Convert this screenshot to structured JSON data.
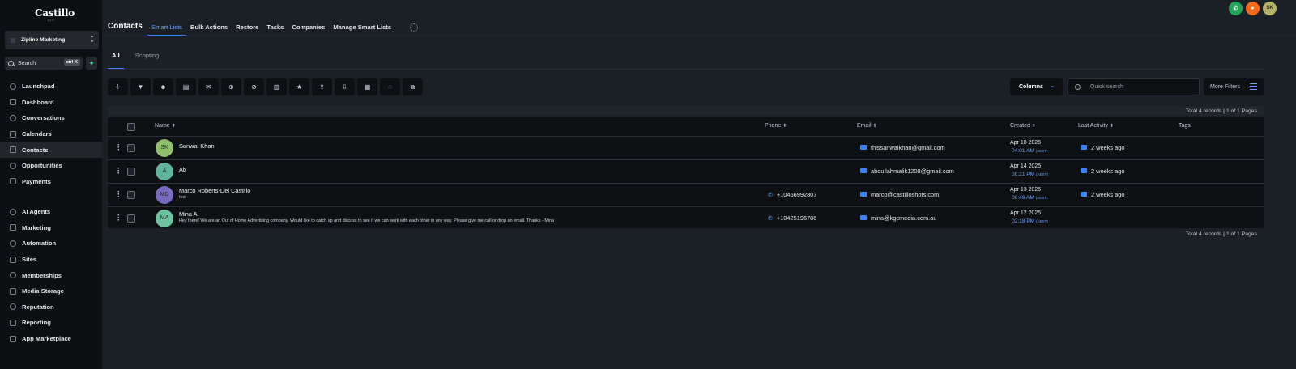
{
  "sidebar": {
    "logo": "Castillo",
    "logo_sub": "LLC",
    "account": "Zipline Marketing",
    "search_label": "Search",
    "search_shortcut": "ctrl K",
    "nav_primary": [
      "Launchpad",
      "Dashboard",
      "Conversations",
      "Calendars",
      "Contacts",
      "Opportunities",
      "Payments"
    ],
    "nav_secondary": [
      "AI Agents",
      "Marketing",
      "Automation",
      "Sites",
      "Memberships",
      "Media Storage",
      "Reputation",
      "Reporting",
      "App Marketplace"
    ],
    "active_item": "Contacts"
  },
  "header": {
    "title": "Contacts",
    "tabs": [
      "Smart Lists",
      "Bulk Actions",
      "Restore",
      "Tasks",
      "Companies",
      "Manage Smart Lists"
    ],
    "active_tab": "Smart Lists",
    "user_initials": "SK"
  },
  "subtabs": [
    "All",
    "Scripting"
  ],
  "toolbar": {
    "icons": [
      "add-icon",
      "filter-icon",
      "robot-icon",
      "sms-icon",
      "email-icon",
      "tag-add-icon",
      "tag-remove-icon",
      "delete-icon",
      "star-icon",
      "export-icon",
      "import-icon",
      "add-to-company-icon",
      "whatsapp-icon",
      "merge-icon"
    ],
    "columns_label": "Columns",
    "search_placeholder": "Quick search",
    "more_filters_label": "More Filters"
  },
  "records_summary": "Total 4 records | 1 of 1 Pages",
  "table": {
    "headers": {
      "name": "Name",
      "phone": "Phone",
      "email": "Email",
      "created": "Created",
      "last_activity": "Last Activity",
      "tags": "Tags"
    },
    "rows": [
      {
        "initials": "SK",
        "avatar_color": "#8fbf6a",
        "name": "Sanwal Khan",
        "sub": "",
        "phone": "",
        "email": "thissanwalkhan@gmail.com",
        "created_date": "Apr 18 2025",
        "created_time": "04:01 AM",
        "tz": "(AEST)",
        "activity": "2 weeks ago"
      },
      {
        "initials": "A",
        "avatar_color": "#5fb59a",
        "name": "Ab",
        "sub": "",
        "phone": "",
        "email": "abdullahmalik1208@gmail.com",
        "created_date": "Apr 14 2025",
        "created_time": "08:21 PM",
        "tz": "(AEST)",
        "activity": "2 weeks ago"
      },
      {
        "initials": "MC",
        "avatar_color": "#7a6bc2",
        "name": "Marco Roberts-Del Castillo",
        "sub": "test",
        "phone": "+10466992807",
        "email": "marco@castilloshots.com",
        "created_date": "Apr 13 2025",
        "created_time": "08:49 AM",
        "tz": "(AEST)",
        "activity": "2 weeks ago"
      },
      {
        "initials": "MA",
        "avatar_color": "#6cc3a0",
        "name": "Mina A.",
        "sub": "Hey there! We are an Out of Home Advertising company. Would like to catch up and discuss to see if we can work with each other in any way. Please give me call or drop an email. Thanks - Mina",
        "phone": "+10425196786",
        "email": "mina@kgcmedia.com.au",
        "created_date": "Apr 12 2025",
        "created_time": "02:18 PM",
        "tz": "(AEST)",
        "activity": ""
      }
    ]
  },
  "colors": {
    "accent": "#3b82f6",
    "sidebar_bg": "#0e0f12",
    "page_bg": "#1b1f26",
    "phone_btn": "#22a55a",
    "notify_btn": "#f26a1b",
    "user_avatar": "#b3b26b"
  }
}
